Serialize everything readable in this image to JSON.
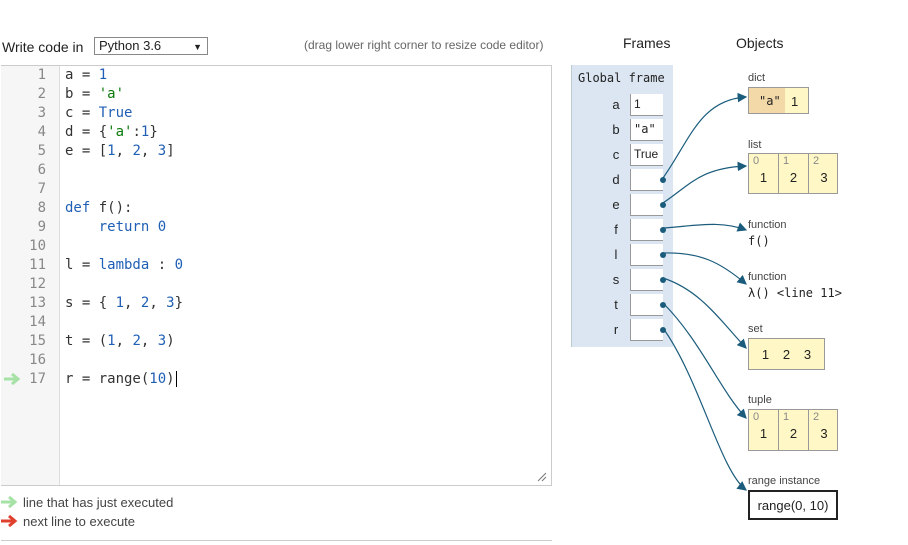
{
  "header": {
    "write_label": "Write code in",
    "language": "Python 3.6",
    "resize_hint": "(drag lower right corner to resize code editor)"
  },
  "editor": {
    "line_numbers": [
      "1",
      "2",
      "3",
      "4",
      "5",
      "6",
      "7",
      "8",
      "9",
      "10",
      "11",
      "12",
      "13",
      "14",
      "15",
      "16",
      "17"
    ]
  },
  "legend": {
    "executed": "line that has just executed",
    "next": "next line to execute"
  },
  "viz": {
    "frames_title": "Frames",
    "objects_title": "Objects",
    "global_frame": "Global frame",
    "vars": [
      {
        "name": "a",
        "value": "1"
      },
      {
        "name": "b",
        "value": "\"a\""
      },
      {
        "name": "c",
        "value": "True"
      },
      {
        "name": "d",
        "value": ""
      },
      {
        "name": "e",
        "value": ""
      },
      {
        "name": "f",
        "value": ""
      },
      {
        "name": "l",
        "value": ""
      },
      {
        "name": "s",
        "value": ""
      },
      {
        "name": "t",
        "value": ""
      },
      {
        "name": "r",
        "value": ""
      }
    ],
    "objects": {
      "dict": {
        "label": "dict",
        "key": "\"a\"",
        "value": "1"
      },
      "list": {
        "label": "list",
        "indices": [
          "0",
          "1",
          "2"
        ],
        "values": [
          "1",
          "2",
          "3"
        ]
      },
      "function_f": {
        "label": "function",
        "name": "f()"
      },
      "function_l": {
        "label": "function",
        "name": "λ() <line 11>"
      },
      "set": {
        "label": "set",
        "values": [
          "1",
          "2",
          "3"
        ]
      },
      "tuple": {
        "label": "tuple",
        "indices": [
          "0",
          "1",
          "2"
        ],
        "values": [
          "1",
          "2",
          "3"
        ]
      },
      "range": {
        "label": "range instance",
        "value": "range(0, 10)"
      }
    }
  },
  "colors": {
    "frame_bg": "#dbe6f2",
    "heap_bg": "#fff8c6",
    "arrow": "#1b5c7c",
    "executed_arrow": "#a6e1a6",
    "next_arrow": "#e0412f"
  }
}
